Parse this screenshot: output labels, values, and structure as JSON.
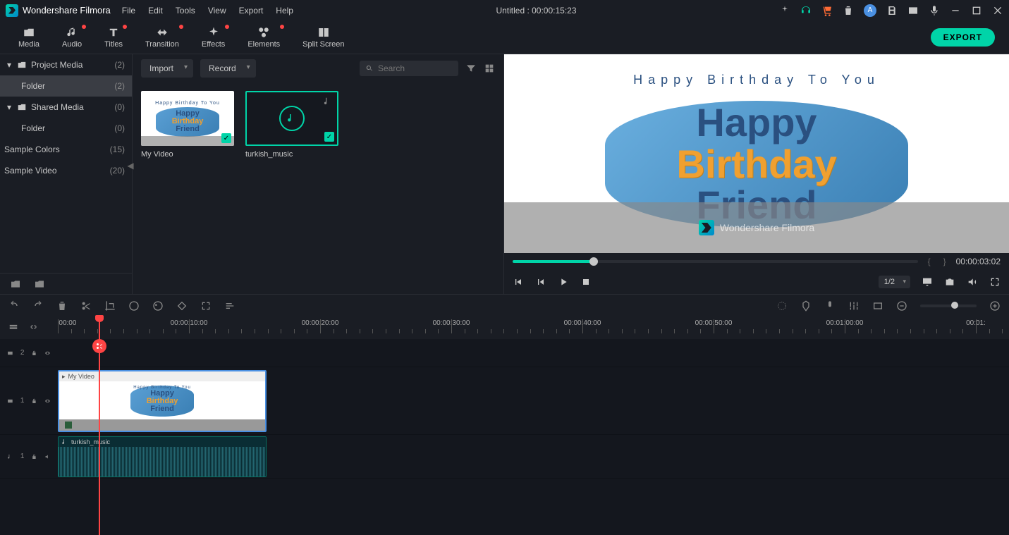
{
  "app": {
    "name": "Wondershare Filmora",
    "title": "Untitled :  00:00:15:23"
  },
  "menu": [
    "File",
    "Edit",
    "Tools",
    "View",
    "Export",
    "Help"
  ],
  "main_tabs": [
    {
      "label": "Media",
      "dot": false
    },
    {
      "label": "Audio",
      "dot": true
    },
    {
      "label": "Titles",
      "dot": true
    },
    {
      "label": "Transition",
      "dot": true
    },
    {
      "label": "Effects",
      "dot": true
    },
    {
      "label": "Elements",
      "dot": true
    },
    {
      "label": "Split Screen",
      "dot": false
    }
  ],
  "export_label": "EXPORT",
  "sidebar": {
    "items": [
      {
        "label": "Project Media",
        "count": "(2)",
        "caret": true,
        "folder": true,
        "selected": false,
        "indent": false
      },
      {
        "label": "Folder",
        "count": "(2)",
        "caret": false,
        "folder": false,
        "selected": true,
        "indent": true
      },
      {
        "label": "Shared Media",
        "count": "(0)",
        "caret": true,
        "folder": true,
        "selected": false,
        "indent": false
      },
      {
        "label": "Folder",
        "count": "(0)",
        "caret": false,
        "folder": false,
        "selected": false,
        "indent": true
      },
      {
        "label": "Sample Colors",
        "count": "(15)",
        "caret": false,
        "folder": false,
        "selected": false,
        "noindent": true
      },
      {
        "label": "Sample Video",
        "count": "(20)",
        "caret": false,
        "folder": false,
        "selected": false,
        "noindent": true
      }
    ]
  },
  "mid": {
    "import_label": "Import",
    "record_label": "Record",
    "search_placeholder": "Search"
  },
  "media": [
    {
      "type": "video",
      "label": "My Video",
      "text": {
        "top": "Happy Birthday To You",
        "l1": "Happy",
        "l2": "Birthday",
        "l3": "Friend"
      }
    },
    {
      "type": "audio",
      "label": "turkish_music"
    }
  ],
  "preview": {
    "top_text": "Happy Birthday To You",
    "l1": "Happy",
    "l2": "Birthday",
    "l3": "Friend",
    "watermark": "Wondershare Filmora",
    "seek_percent": 20,
    "time": "00:00:03:02",
    "quality": "1/2"
  },
  "ruler": {
    "marks": [
      "00:00:00:00",
      "00:00:10:00",
      "00:00:20:00",
      "00:00:30:00",
      "00:00:40:00",
      "00:00:50:00",
      "00:01:00:00",
      "00:01:"
    ]
  },
  "tracks": {
    "t2": {
      "label": "2"
    },
    "t1": {
      "label": "1",
      "clip_label": "My Video"
    },
    "a1": {
      "label": "1",
      "clip_label": "turkish_music"
    }
  }
}
